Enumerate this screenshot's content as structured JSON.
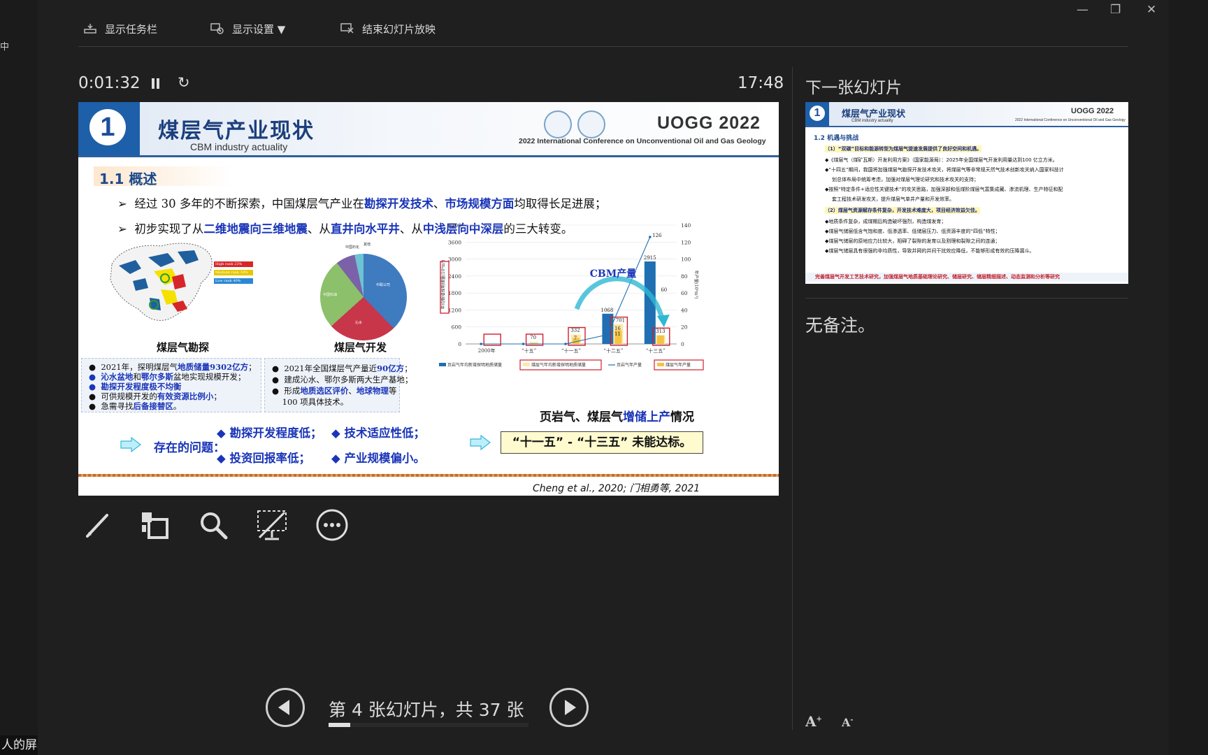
{
  "side": {
    "left_glyph": "中",
    "share_label": "人的屏幕共享"
  },
  "window": {
    "minimize": "—",
    "restore": "❐",
    "close": "✕"
  },
  "toolbar": {
    "taskbar": "显示任务栏",
    "display_settings": "显示设置 ▼",
    "end_show": "结束幻灯片放映"
  },
  "presenter": {
    "elapsed": "0:01:32",
    "clock": "17:48",
    "slide_counter": "第 4 张幻灯片，共 37 张",
    "progress_fraction": 0.108
  },
  "slide": {
    "number": "1",
    "title": "煤层气产业现状",
    "subtitle": "CBM industry actuality",
    "brand": "UOGG 2022",
    "conference": "2022 International Conference on Unconventional Oil and Gas Geology",
    "section": "1.1 概述",
    "bullet1": {
      "a": "经过 30 多年的不断探索，中国煤层气产业在",
      "b": "勘探开发技术",
      "c": "、",
      "d": "市场规模方面",
      "e": "均取得长足进展；"
    },
    "bullet2": {
      "a": "初步实现了从",
      "b": "二维地震向三维地震",
      "c": "、从",
      "d": "直井向水平井",
      "e": "、从",
      "f": "中浅层向中深层",
      "g": "的三大转变。"
    },
    "map_caption": "煤层气勘探",
    "map_legend": [
      "High rank 23%",
      "Medium rank 39%",
      "Low rank 40%"
    ],
    "pie_caption": "煤层气开发",
    "pie_labels": {
      "a": "中国石化",
      "b": "其他",
      "c": "中国石油",
      "d": "中联公司",
      "e": "沁水",
      "f": "鄂尔多斯"
    },
    "box1": {
      "l1a": "2021年，探明煤层气",
      "l1b": "地质储量9302亿方",
      "l1c": "；",
      "l2a": "沁水盆地",
      "l2b": "和",
      "l2c": "鄂尔多斯",
      "l2d": "盆地实现规模开发；",
      "l3": "勘探开发程度极不均衡",
      "l4a": "可供规模开发的",
      "l4b": "有效资源比例小",
      "l4c": "；",
      "l5a": "急需寻找",
      "l5b": "后备接替区",
      "l5c": "。"
    },
    "box2": {
      "l1a": "2021年全国煤层气产量近",
      "l1b": "90亿方",
      "l1c": "；",
      "l2": "建成沁水、鄂尔多斯两大生产基地；",
      "l3a": "形成",
      "l3b": "地质选区评价",
      "l3c": "、",
      "l3d": "地球物理",
      "l3e": "等",
      "l4": "100 项具体技术。"
    },
    "chart_caption_a": "页岩气、煤层气",
    "chart_caption_b": "增储上产",
    "chart_caption_c": "情况",
    "chart_annotation": "CBM产量",
    "problems_label": "存在的问题：",
    "problems": [
      "勘探开发程度低；",
      "技术适应性低；",
      "投资回报率低；",
      "产业规模偏小。"
    ],
    "conclusion": "“十一五” - “十三五” 未能达标。",
    "citation": "Cheng et al., 2020; 门相勇等, 2021"
  },
  "chart_data": {
    "type": "bar",
    "categories": [
      "2000年",
      "“十五”",
      "“十一五”",
      "“十二五”",
      "“十三五”"
    ],
    "series": [
      {
        "name": "页岩气年均新增探明地质储量",
        "type": "bar",
        "axis": "left",
        "values": [
          0,
          0,
          0,
          1068,
          2915
        ]
      },
      {
        "name": "煤层气年均新增探明地质储量",
        "type": "bar",
        "axis": "left",
        "values": [
          0,
          70,
          332,
          701,
          313
        ]
      },
      {
        "name": "页岩气年产量",
        "type": "line",
        "axis": "right",
        "values": [
          0,
          0,
          0,
          11,
          126
        ]
      },
      {
        "name": "煤层气年产量",
        "type": "bar",
        "axis": "right",
        "values": [
          0,
          1,
          7,
          16,
          10
        ]
      }
    ],
    "left_axis": {
      "label": "年均新增探明储量(10⁸m³)",
      "ticks": [
        0,
        600,
        1200,
        1800,
        2400,
        3000,
        3600,
        4200
      ],
      "ylim": [
        0,
        4200
      ]
    },
    "right_axis": {
      "label": "年产量(10⁸m³)",
      "ticks": [
        0,
        20,
        40,
        60,
        80,
        100,
        120,
        140
      ],
      "ylim": [
        0,
        140
      ]
    },
    "data_labels": [
      "70",
      "332",
      "7",
      "1068",
      "701",
      "16",
      "11",
      "2915",
      "126",
      "313",
      "60"
    ],
    "legend_position": "bottom"
  },
  "next": {
    "label": "下一张幻灯片",
    "number": "1",
    "title": "煤层气产业现状",
    "subtitle": "CBM industry actuality",
    "brand": "UOGG 2022",
    "conference": "2022 International Conference on Unconventional Oil and Gas Geology",
    "section": "1.2 机遇与挑战",
    "rows": [
      "（1）“双碳”目标和能源转型为煤层气提速发展提供了良好空间和机遇。",
      "◆《煤层气（煤矿瓦斯）开发利用方案》（国家能源局）：2025年全国煤层气开发利用量达到100 亿立方米。",
      "◆“十四五”期间，我国将加强煤层气勘探开发技术攻关，将煤层气等非常规天然气技术创新攻关纳入国家科技计",
      "划总体布局中统筹考虑，加强对煤层气理论研究和技术攻关的支持；",
      "◆按照“特定条件+适应性关键技术”的攻关思路，加强深部和低煤阶煤层气富集成藏、渗流机理、生产特征和配",
      "套工程技术研发攻关，提升煤层气单井产量和开发效率。",
      "（2）煤层气资源赋存条件复杂，开发技术难度大，项目经济效益欠佳。",
      "◆地质条件复杂，成煤期后构造破坏强烈，构造煤发育；",
      "◆煤层气储层低含气饱和度、低渗透率、低储层压力、低资源丰度的“四低”特性；",
      "◆煤层气储层的原地应力比较大，阻碍了裂隙的发育以及割理和裂隙之间的连通；",
      "◆煤层气储层具有很强的非均质性，导致井网的井间干扰效应降低，不能够形成有效的压降漏斗。"
    ],
    "bottom": "完善煤层气开发工艺技术研究，加强煤层气地质基础理论研究、储层研究、储层精细描述、动态监测和分析等研究"
  },
  "notes": "无备注。"
}
